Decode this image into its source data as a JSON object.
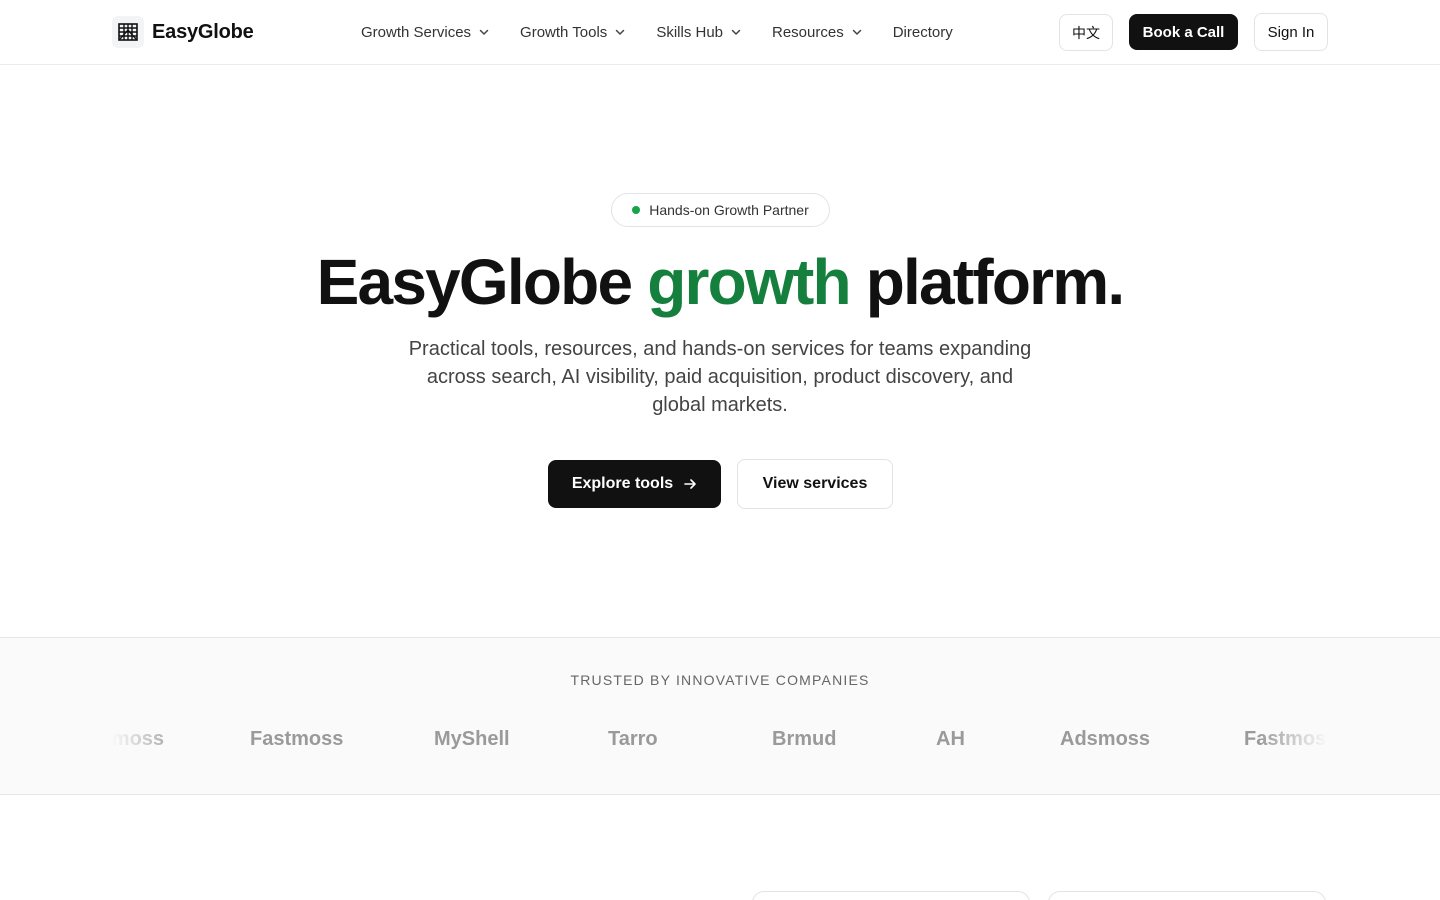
{
  "header": {
    "brand": "EasyGlobe",
    "nav": [
      {
        "label": "Growth Services",
        "has_dropdown": true
      },
      {
        "label": "Growth Tools",
        "has_dropdown": true
      },
      {
        "label": "Skills Hub",
        "has_dropdown": true
      },
      {
        "label": "Resources",
        "has_dropdown": true
      },
      {
        "label": "Directory",
        "has_dropdown": false
      }
    ],
    "language_label": "中文",
    "book_call_label": "Book a Call",
    "sign_in_label": "Sign In"
  },
  "hero": {
    "badge_text": "Hands-on Growth Partner",
    "title_part1": "EasyGlobe ",
    "title_accent": "growth",
    "title_part2": " platform.",
    "subtitle": "Practical tools, resources, and hands-on services for teams expanding across search, AI visibility, paid acquisition, product discovery, and global markets.",
    "primary_cta": "Explore tools",
    "secondary_cta": "View services"
  },
  "trusted": {
    "label": "TRUSTED BY INNOVATIVE COMPANIES",
    "logos": [
      "Adsmoss",
      "Fastmoss",
      "MyShell",
      "Tarro",
      "Brmud",
      "AH",
      "Adsmoss",
      "Fastmoss"
    ]
  },
  "colors": {
    "accent": "#15803d",
    "badge_dot": "#16a34a",
    "primary_button": "#111111"
  }
}
